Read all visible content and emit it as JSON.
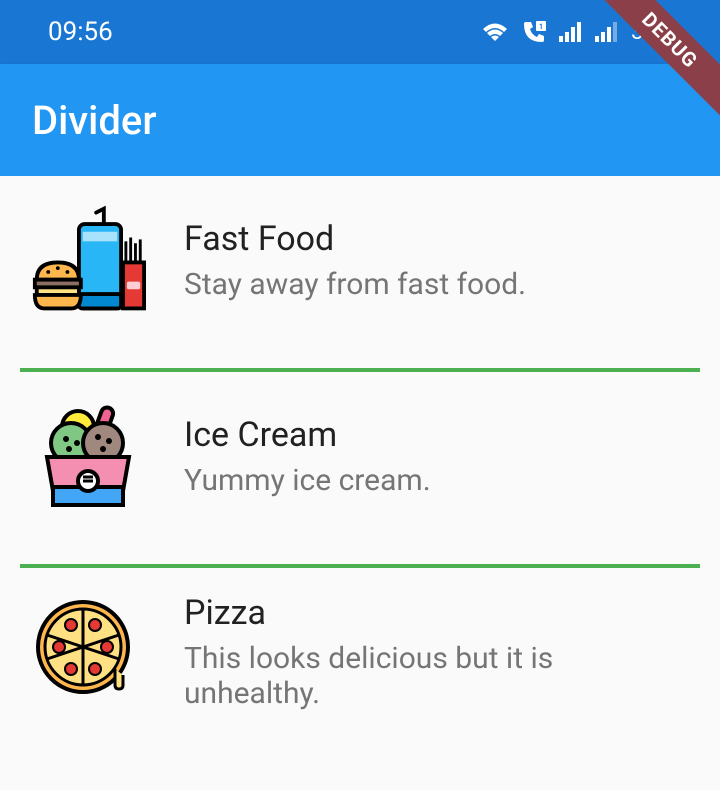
{
  "status": {
    "time": "09:56",
    "battery": "33%"
  },
  "debug": {
    "label": "DEBUG"
  },
  "appbar": {
    "title": "Divider"
  },
  "items": [
    {
      "icon": "fast-food",
      "title": "Fast Food",
      "subtitle": "Stay away from fast food."
    },
    {
      "icon": "ice-cream",
      "title": "Ice Cream",
      "subtitle": "Yummy ice cream."
    },
    {
      "icon": "pizza",
      "title": "Pizza",
      "subtitle": "This looks delicious but it is unhealthy."
    }
  ]
}
